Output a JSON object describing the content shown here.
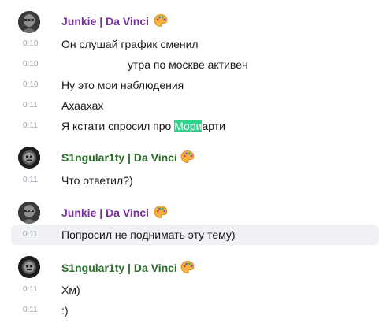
{
  "groups": [
    {
      "author": "Junkie | Da Vinci",
      "avatar_icon": "knight-avatar",
      "badge_icon": "palette-icon",
      "messages": [
        {
          "time": "0:10",
          "text": "Он слушай график сменил"
        },
        {
          "time": "0:10",
          "text": "утра по москве активен"
        },
        {
          "time": "0:10",
          "text": "Ну это мои наблюдения"
        },
        {
          "time": "0:11",
          "text": "Ахаахах"
        },
        {
          "time": "0:11",
          "text_before": "Я кстати спросил про ",
          "text_highlight": "Мори",
          "text_after": "арти"
        }
      ]
    },
    {
      "author": "S1ngular1ty | Da Vinci",
      "avatar_icon": "skull-helmet-avatar",
      "badge_icon": "palette-icon",
      "messages": [
        {
          "time": "0:11",
          "text": "Что ответил?)"
        }
      ]
    },
    {
      "author": "Junkie | Da Vinci",
      "avatar_icon": "knight-avatar",
      "badge_icon": "palette-icon",
      "messages": [
        {
          "time": "0:11",
          "text": "Попросил не поднимать эту тему)"
        }
      ]
    },
    {
      "author": "S1ngular1ty | Da Vinci",
      "avatar_icon": "skull-helmet-avatar",
      "badge_icon": "palette-icon",
      "messages": [
        {
          "time": "0:11",
          "text": "Хм)"
        },
        {
          "time": "0:11",
          "text": ":)"
        }
      ]
    }
  ],
  "colors": {
    "junkie_name": "#7a2ea0",
    "singularity_name": "#2a6b2a",
    "highlight": "#2fd28a",
    "hover_row": "#f0f1f4",
    "timestamp": "#9aa0a8"
  }
}
